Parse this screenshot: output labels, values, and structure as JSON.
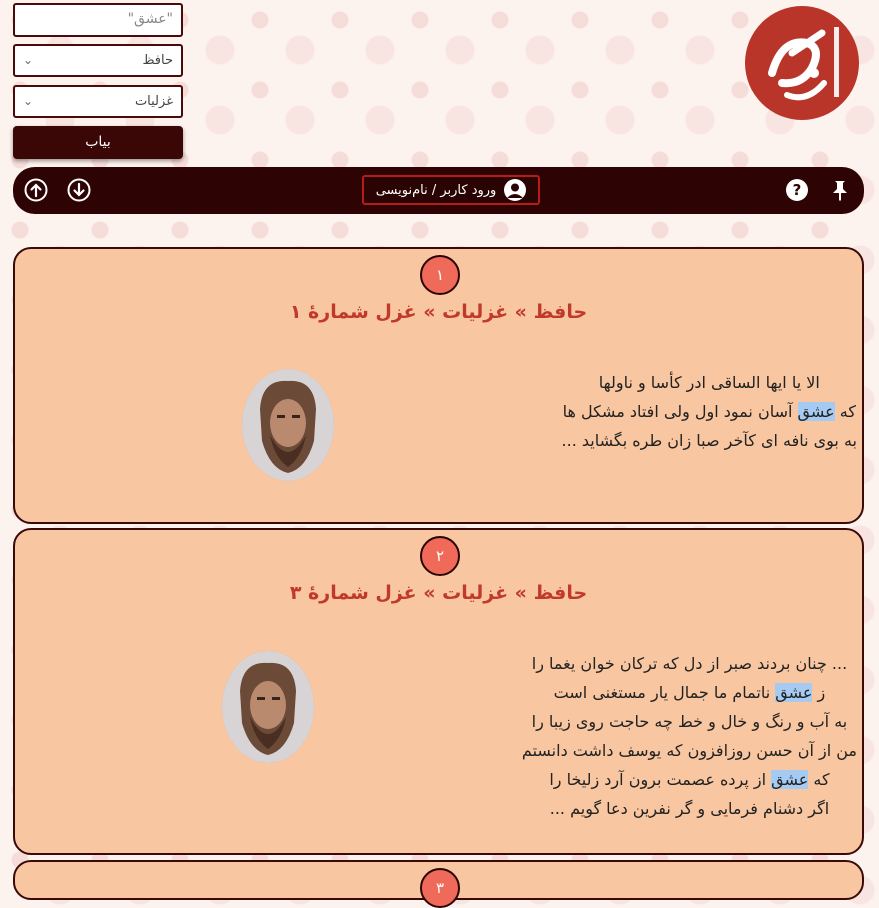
{
  "search": {
    "value": "\"عشق\""
  },
  "filters": {
    "poet": "حافظ",
    "category": "غزلیات"
  },
  "find_button": "بیاب",
  "logo": {
    "text": "گنجور"
  },
  "navbar": {
    "login_label": "ورود کاربر / نام‌نویسی"
  },
  "results": [
    {
      "number": "۱",
      "title": "حافظ » غزلیات » غزل شمارهٔ ۱",
      "verses": [
        {
          "before": "",
          "hl": "",
          "after": "الا یا ایها الساقی ادر کأسا و ناولها"
        },
        {
          "before": "که ",
          "hl": "عشق",
          "after": " آسان نمود اول ولی افتاد مشکل ها"
        },
        {
          "before": "",
          "hl": "",
          "after": "به بوی نافه ای کآخر صبا زان طره بگشاید ..."
        }
      ]
    },
    {
      "number": "۲",
      "title": "حافظ » غزلیات » غزل شمارهٔ ۳",
      "verses": [
        {
          "before": "",
          "hl": "",
          "after": "... چنان بردند صبر از دل که ترکان خوان یغما را"
        },
        {
          "before": "ز ",
          "hl": "عشق",
          "after": " ناتمام ما جمال یار مستغنی است"
        },
        {
          "before": "",
          "hl": "",
          "after": "به آب و رنگ و خال و خط چه حاجت روی زیبا را"
        },
        {
          "before": "",
          "hl": "",
          "after": "من از آن حسن روزافزون که یوسف داشت دانستم"
        },
        {
          "before": "که ",
          "hl": "عشق",
          "after": " از پرده عصمت برون آرد زلیخا را"
        },
        {
          "before": "",
          "hl": "",
          "after": "اگر دشنام فرمایی و گر نفرین دعا گویم ..."
        }
      ]
    },
    {
      "number": "۳"
    }
  ],
  "colors": {
    "accent": "#2d0303",
    "card_bg": "#f8c6a0",
    "badge": "#f06a5a",
    "title": "#c0392b",
    "highlight": "#a5cbf3"
  },
  "icons": [
    "pin-icon",
    "help-icon",
    "user-icon",
    "scroll-down-icon",
    "scroll-up-icon",
    "chevron-down-icon"
  ]
}
